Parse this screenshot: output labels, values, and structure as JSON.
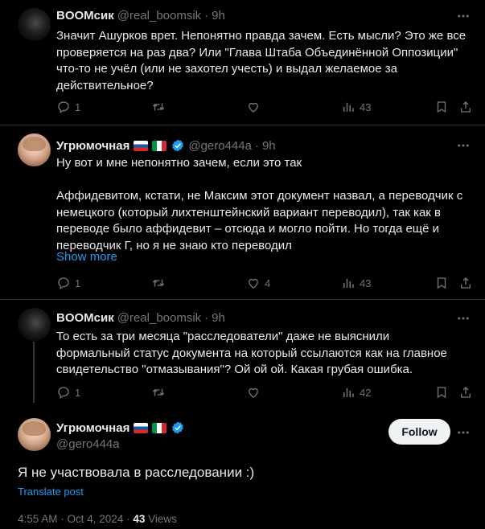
{
  "replies": [
    {
      "name": "BOOMсик",
      "handle": "@real_boomsik",
      "time": "9h",
      "text": "Значит Ашурков врет. Непонятно правда зачем. Есть мысли? Это же все проверяется на раз два? Или \"Глава Штаба Объединённой Оппозиции\" что-то не учёл (или не захотел учесть) и выдал желаемое за действительное?",
      "replies": "1",
      "reposts": "",
      "likes": "",
      "views": "43"
    },
    {
      "name": "Угрюмочная",
      "handle": "@gero444a",
      "time": "9h",
      "text": "Ну вот и мне непонятно зачем, если это так\n\nАффидевитом, кстати, не Максим этот документ назвал, а переводчик с немецкого (который лихтенштейнский вариант переводил), так как в переводе было аффидевит – отсюда и могло пойти. Но тогда ещё и переводчик Г, но я не знаю кто переводил",
      "show_more": "Show more",
      "replies": "1",
      "reposts": "",
      "likes": "4",
      "views": "43"
    },
    {
      "name": "BOOMсик",
      "handle": "@real_boomsik",
      "time": "9h",
      "text": "То есть за три месяца \"расследователи\" даже не выяснили формальный статус документа на который ссылаются как на главное свидетельство \"отмазывания\"? Ой ой ой. Какая грубая ошибка.",
      "replies": "1",
      "reposts": "",
      "likes": "",
      "views": "42"
    }
  ],
  "main_post": {
    "name": "Угрюмочная",
    "handle": "@gero444a",
    "follow_label": "Follow",
    "text": "Я не участвовала в расследовании :)",
    "translate_label": "Translate post",
    "timestamp": "4:55 AM · Oct 4, 2024 · ",
    "views_count": "43",
    "views_label": " Views"
  },
  "colors": {
    "background": "#000000",
    "text": "#e7e9ea",
    "muted": "#71767b",
    "link": "#1d9bf0",
    "verified": "#1d9bf0"
  }
}
